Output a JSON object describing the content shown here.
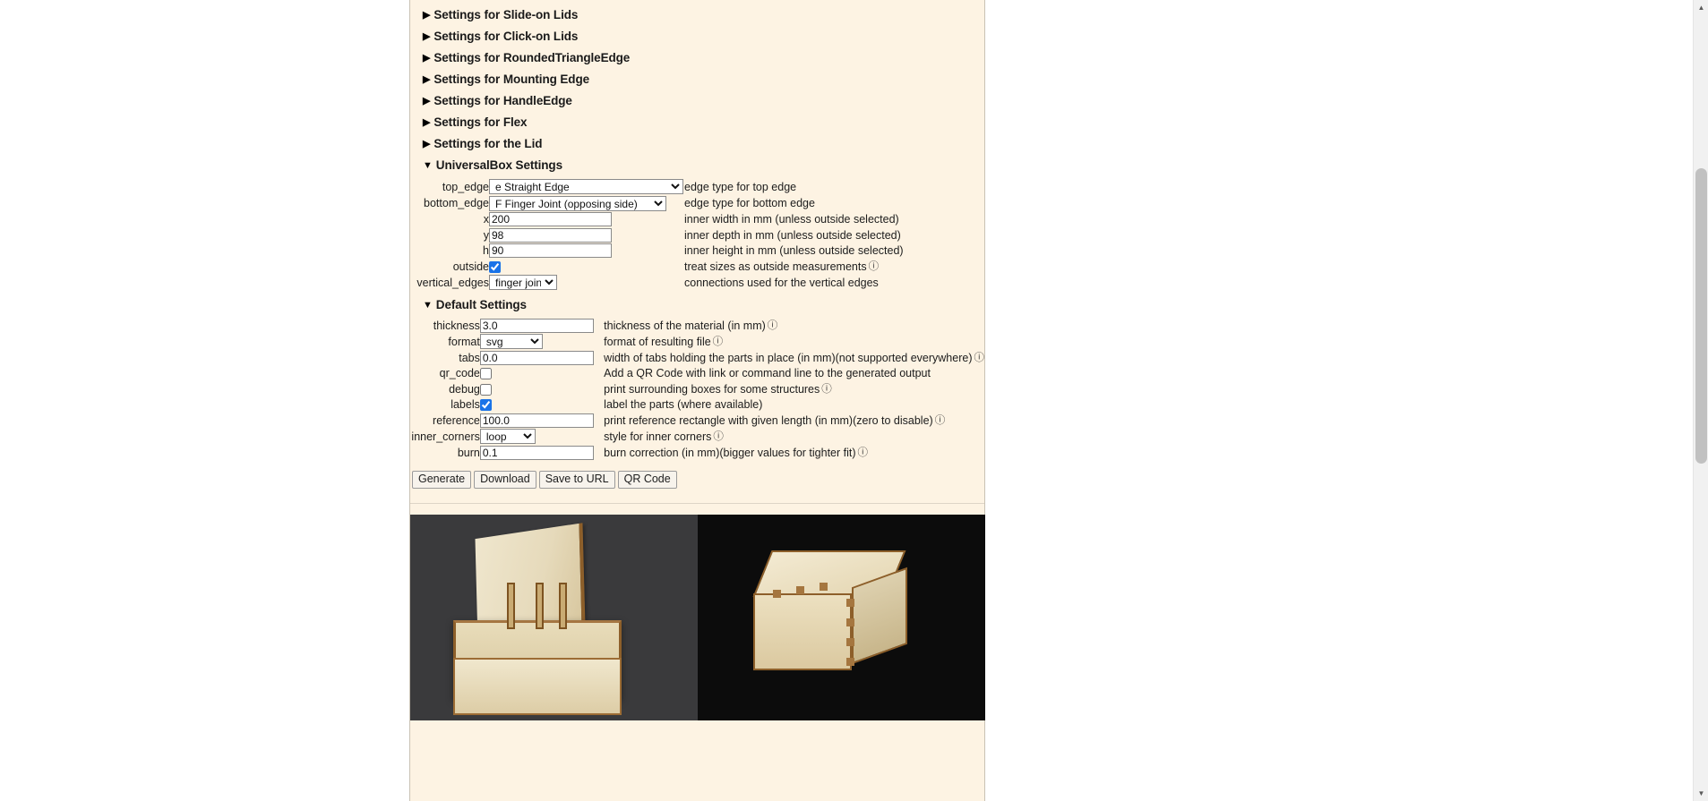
{
  "collapsed_groups": [
    {
      "label": "Settings for Slide-on Lids",
      "marker": "▶"
    },
    {
      "label": "Settings for Click-on Lids",
      "marker": "▶"
    },
    {
      "label": "Settings for RoundedTriangleEdge",
      "marker": "▶"
    },
    {
      "label": "Settings for Mounting Edge",
      "marker": "▶"
    },
    {
      "label": "Settings for HandleEdge",
      "marker": "▶"
    },
    {
      "label": "Settings for Flex",
      "marker": "▶"
    },
    {
      "label": "Settings for the Lid",
      "marker": "▶"
    }
  ],
  "universalbox": {
    "header": "UniversalBox Settings",
    "marker": "▼",
    "rows": [
      {
        "label": "top_edge",
        "type": "select",
        "value": "e Straight Edge",
        "desc": "edge type for top edge",
        "info": ""
      },
      {
        "label": "bottom_edge",
        "type": "select",
        "value": "F Finger Joint (opposing side)",
        "desc": "edge type for bottom edge",
        "info": ""
      },
      {
        "label": "x",
        "type": "text",
        "value": "200",
        "desc": "inner width in mm (unless outside selected)",
        "info": ""
      },
      {
        "label": "y",
        "type": "text",
        "value": "98",
        "desc": "inner depth in mm (unless outside selected)",
        "info": ""
      },
      {
        "label": "h",
        "type": "text",
        "value": "90",
        "desc": "inner height in mm (unless outside selected)",
        "info": ""
      },
      {
        "label": "outside",
        "type": "checkbox",
        "value": "checked",
        "desc": "treat sizes as outside measurements",
        "info": "ⓘ"
      },
      {
        "label": "vertical_edges",
        "type": "select",
        "value": "finger joints",
        "desc": "connections used for the vertical edges",
        "info": ""
      }
    ]
  },
  "defaults": {
    "header": "Default Settings",
    "marker": "▼",
    "rows": [
      {
        "label": "thickness",
        "type": "text",
        "value": "3.0",
        "desc": "thickness of the material (in mm)",
        "info": "ⓘ"
      },
      {
        "label": "format",
        "type": "select",
        "value": "svg",
        "desc": "format of resulting file",
        "info": "ⓘ"
      },
      {
        "label": "tabs",
        "type": "text",
        "value": "0.0",
        "desc": "width of tabs holding the parts in place (in mm)(not supported everywhere)",
        "info": "ⓘ"
      },
      {
        "label": "qr_code",
        "type": "checkbox",
        "value": "",
        "desc": "Add a QR Code with link or command line to the generated output",
        "info": ""
      },
      {
        "label": "debug",
        "type": "checkbox",
        "value": "",
        "desc": "print surrounding boxes for some structures",
        "info": "ⓘ"
      },
      {
        "label": "labels",
        "type": "checkbox",
        "value": "checked",
        "desc": "label the parts (where available)",
        "info": ""
      },
      {
        "label": "reference",
        "type": "text",
        "value": "100.0",
        "desc": "print reference rectangle with given length (in mm)(zero to disable)",
        "info": "ⓘ"
      },
      {
        "label": "inner_corners",
        "type": "select",
        "value": "loop",
        "desc": "style for inner corners",
        "info": "ⓘ"
      },
      {
        "label": "burn",
        "type": "text",
        "value": "0.1",
        "desc": "burn correction (in mm)(bigger values for tighter fit)",
        "info": "ⓘ"
      }
    ]
  },
  "buttons": [
    {
      "label": "Generate"
    },
    {
      "label": "Download"
    },
    {
      "label": "Save to URL"
    },
    {
      "label": "QR Code"
    }
  ],
  "photos": [
    {
      "name": "open-box-photo"
    },
    {
      "name": "closed-box-photo"
    }
  ],
  "scrollbar": {
    "up_arrow": "▲",
    "down_arrow": "▼"
  },
  "colors": {
    "page_background": "#fdf3e3",
    "outer_background": "#ffffff",
    "text": "#1c1c1c",
    "border": "#c9c2b4",
    "checkbox_accent": "#1a73e8",
    "button_face": "#f7f3ec"
  }
}
